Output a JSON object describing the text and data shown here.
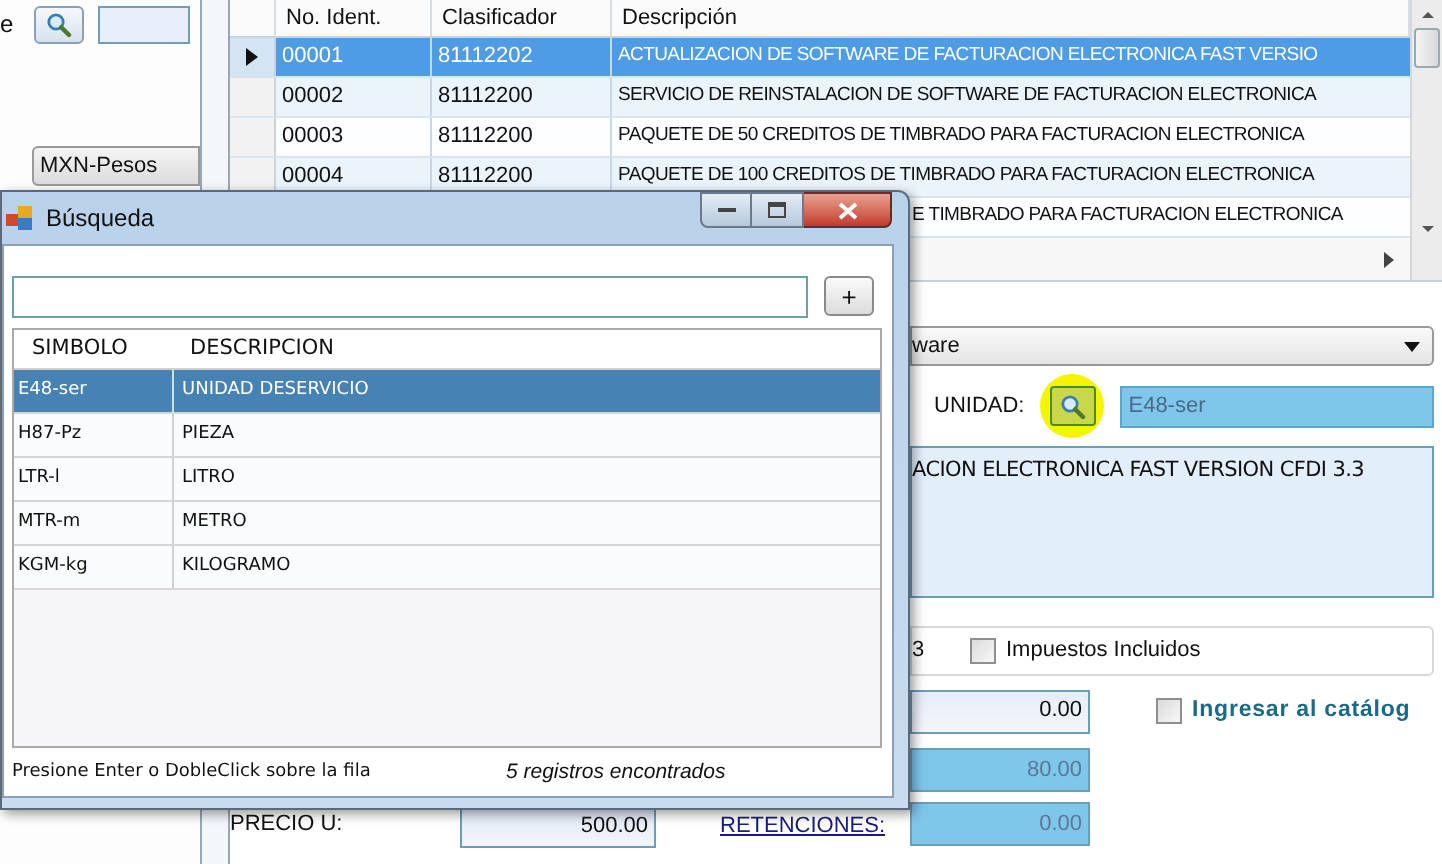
{
  "left_panel": {
    "label": "e",
    "currency": "MXN-Pesos"
  },
  "grid": {
    "columns": [
      "No. Ident.",
      "Clasificador",
      "Descripción"
    ],
    "rows": [
      {
        "kind": "full",
        "selected": true,
        "id": "00001",
        "code": "81112202",
        "description": "ACTUALIZACION DE SOFTWARE DE FACTURACION ELECTRONICA FAST VERSIO"
      },
      {
        "kind": "full",
        "selected": false,
        "id": "00002",
        "code": "81112200",
        "description": "SERVICIO DE REINSTALACION DE SOFTWARE DE FACTURACION ELECTRONICA"
      },
      {
        "kind": "full",
        "selected": false,
        "id": "00003",
        "code": "81112200",
        "description": "PAQUETE DE 50 CREDITOS DE TIMBRADO PARA FACTURACION ELECTRONICA"
      },
      {
        "kind": "full",
        "selected": false,
        "id": "00004",
        "code": "81112200",
        "description": "PAQUETE DE 100 CREDITOS DE TIMBRADO PARA FACTURACION ELECTRONICA"
      },
      {
        "kind": "partial",
        "selected": false,
        "description": "E TIMBRADO PARA FACTURACION ELECTRONICA"
      }
    ]
  },
  "form": {
    "category_tail": "ware",
    "unit_label": "UNIDAD:",
    "unit_value": "E48-ser",
    "description_tail": "ACION ELECTRONICA FAST VERSION CFDI 3.3",
    "group_tail": "3",
    "taxes_included": {
      "label": "Impuestos Incluidos",
      "checked": false
    },
    "amount_1": "0.00",
    "add_to_catalog": {
      "label": "Ingresar al catálog",
      "checked": false
    },
    "amount_2": "80.00",
    "amount_3": "0.00",
    "price_label": "PRECIO U:",
    "price": "500.00",
    "withholdings_link": "RETENCIONES:"
  },
  "dialog": {
    "title": "Búsqueda",
    "add_button": "+",
    "columns": [
      "SIMBOLO",
      "DESCRIPCION"
    ],
    "rows": [
      {
        "selected": true,
        "symbol": "E48-ser",
        "description": "UNIDAD DESERVICIO"
      },
      {
        "selected": false,
        "symbol": "H87-Pz",
        "description": "PIEZA"
      },
      {
        "selected": false,
        "symbol": "LTR-l",
        "description": "LITRO"
      },
      {
        "selected": false,
        "symbol": "MTR-m",
        "description": "METRO"
      },
      {
        "selected": false,
        "symbol": "KGM-kg",
        "description": "KILOGRAMO"
      }
    ],
    "hint": "Presione Enter o DobleClick sobre la fila",
    "count": "5 registros encontrados"
  }
}
